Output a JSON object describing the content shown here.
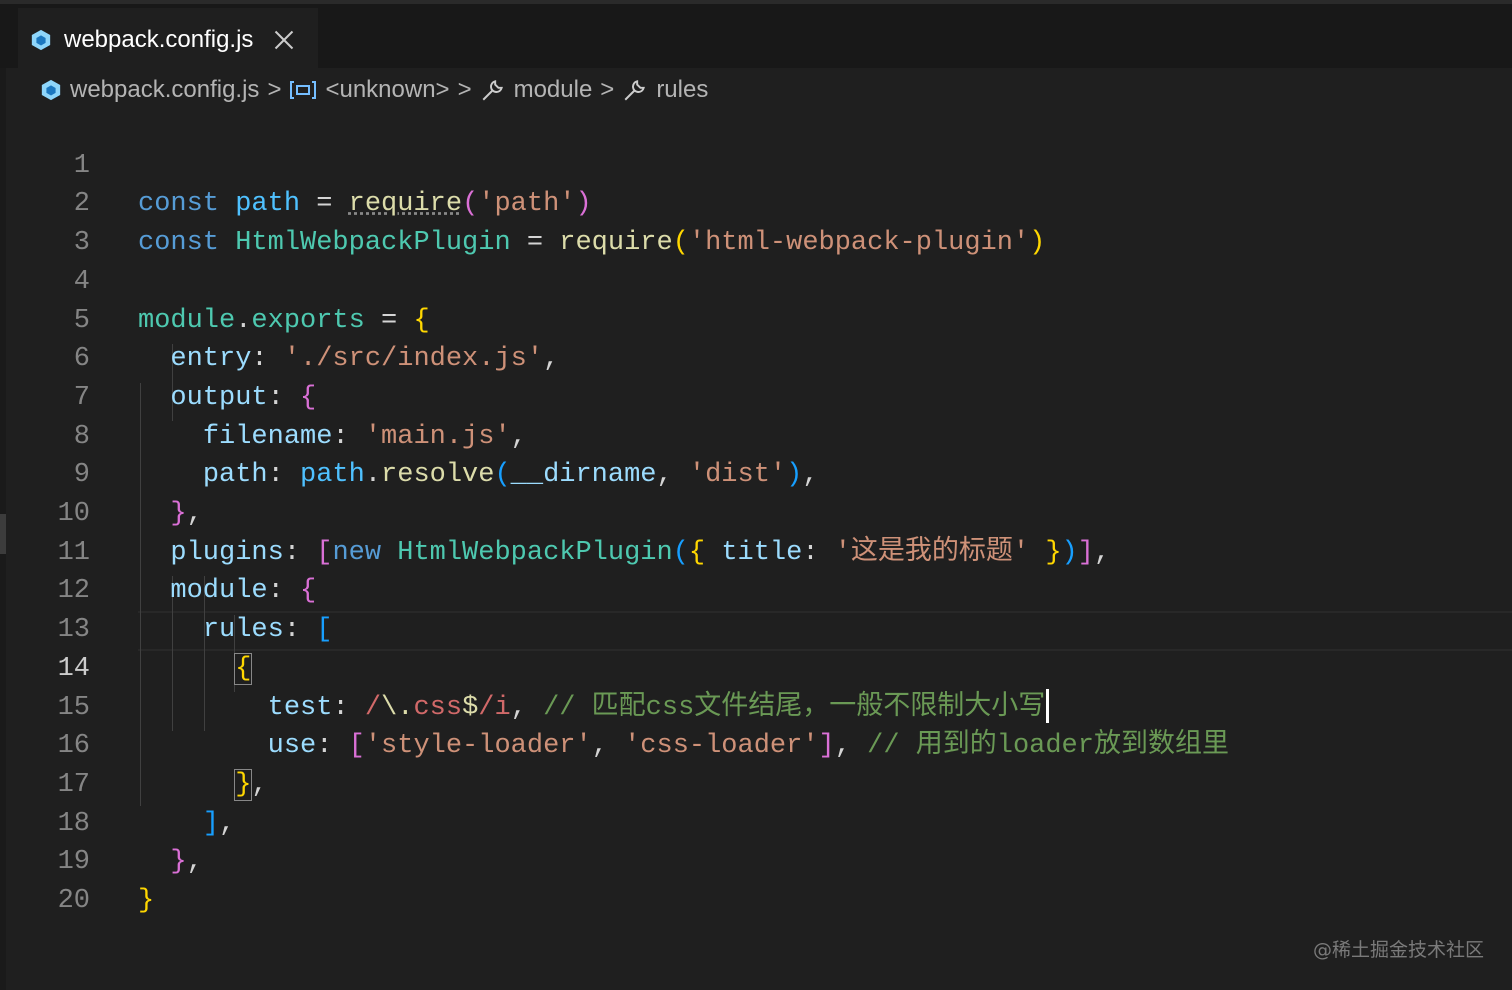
{
  "tab": {
    "title": "webpack.config.js",
    "icon": "webpack-cube-icon"
  },
  "breadcrumb": {
    "file": "webpack.config.js",
    "symbol1": "<unknown>",
    "symbol2": "module",
    "symbol3": "rules",
    "separator": ">"
  },
  "gutter": {
    "line_numbers": [
      "1",
      "2",
      "3",
      "4",
      "5",
      "6",
      "7",
      "8",
      "9",
      "10",
      "11",
      "12",
      "13",
      "14",
      "15",
      "16",
      "17",
      "18",
      "19",
      "20"
    ],
    "active_line": "14"
  },
  "code": {
    "l1": {
      "t1": "const",
      "t2": "path",
      "t3": " = ",
      "t4": "require",
      "t5": "(",
      "t6": "'path'",
      "t7": ")"
    },
    "l2": {
      "t1": "const",
      "t2": "HtmlWebpackPlugin",
      "t3": " = ",
      "t4": "require",
      "t5": "(",
      "t6": "'html-webpack-plugin'",
      "t7": ")"
    },
    "l4": {
      "t1": "module",
      "t2": ".",
      "t3": "exports",
      "t4": " = ",
      "t5": "{"
    },
    "l5": {
      "t1": "entry",
      "t2": ": ",
      "t3": "'./src/index.js'",
      "t4": ","
    },
    "l6": {
      "t1": "output",
      "t2": ": ",
      "t3": "{"
    },
    "l7": {
      "t1": "filename",
      "t2": ": ",
      "t3": "'main.js'",
      "t4": ","
    },
    "l8": {
      "t1": "path",
      "t2": ": ",
      "t3": "path",
      "t4": ".",
      "t5": "resolve",
      "t6": "(",
      "t7": "__dirname",
      "t8": ", ",
      "t9": "'dist'",
      "t10": ")",
      "t11": ","
    },
    "l9": {
      "t1": "}",
      "t2": ","
    },
    "l10": {
      "t1": "plugins",
      "t2": ": ",
      "t3": "[",
      "t4": "new",
      "t5": " ",
      "t6": "HtmlWebpackPlugin",
      "t7": "(",
      "t8": "{",
      "t9": " ",
      "t10": "title",
      "t11": ": ",
      "t12": "'这是我的标题'",
      "t13": " ",
      "t14": "}",
      "t15": ")",
      "t16": "]",
      "t17": ","
    },
    "l11": {
      "t1": "module",
      "t2": ": ",
      "t3": "{"
    },
    "l12": {
      "t1": "rules",
      "t2": ": ",
      "t3": "["
    },
    "l13": {
      "t1": "{"
    },
    "l14": {
      "t1": "test",
      "t2": ": ",
      "t3": "/",
      "t4": "\\.",
      "t5": "css",
      "t6": "$",
      "t7": "/i",
      "t8": ", ",
      "t9": "// 匹配css文件结尾，一般不限制大小写"
    },
    "l15": {
      "t1": "use",
      "t2": ": ",
      "t3": "[",
      "t4": "'style-loader'",
      "t5": ", ",
      "t6": "'css-loader'",
      "t7": "]",
      "t8": ", ",
      "t9": "// 用到的loader放到数组里"
    },
    "l16": {
      "t1": "}",
      "t2": ","
    },
    "l17": {
      "t1": "]",
      "t2": ","
    },
    "l18": {
      "t1": "}",
      "t2": ","
    },
    "l19": {
      "t1": "}"
    }
  },
  "watermark": "@稀土掘金技术社区"
}
